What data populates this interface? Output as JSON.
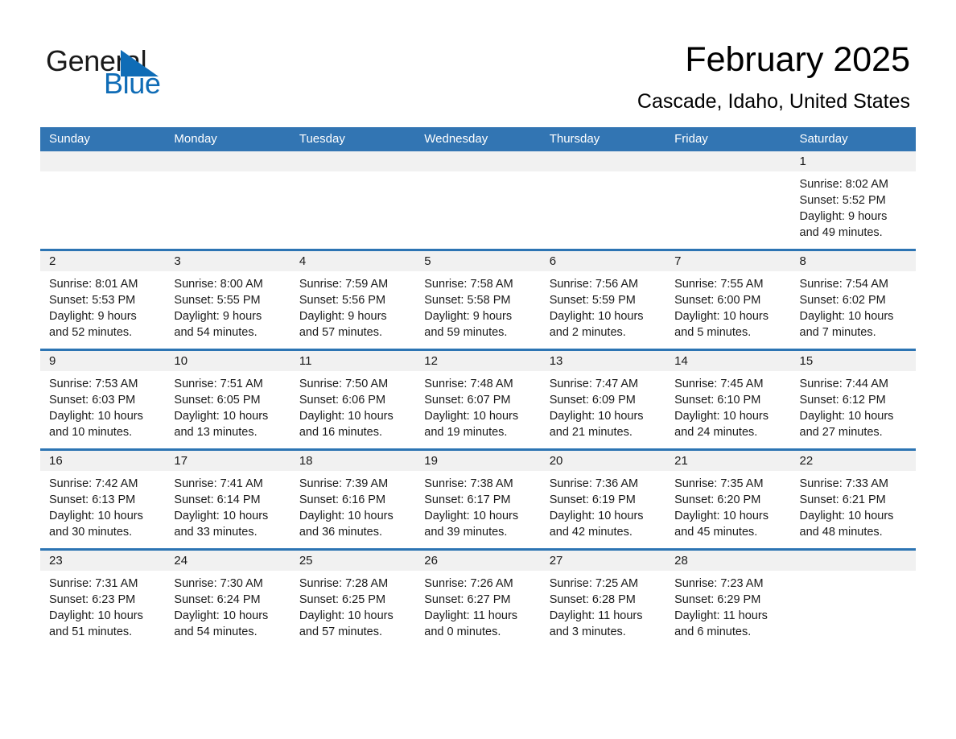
{
  "brand": {
    "name_part1": "General",
    "name_part2": "Blue",
    "logo_icon": "triangle-logo-icon",
    "accent_color": "#0f6cb6"
  },
  "header": {
    "title": "February 2025",
    "subtitle": "Cascade, Idaho, United States"
  },
  "calendar": {
    "header_bg": "#3275b3",
    "row_rule_color": "#2c74b3",
    "daynum_band_bg": "#f1f1f1",
    "weekdays": [
      "Sunday",
      "Monday",
      "Tuesday",
      "Wednesday",
      "Thursday",
      "Friday",
      "Saturday"
    ],
    "weeks": [
      [
        {
          "day": ""
        },
        {
          "day": ""
        },
        {
          "day": ""
        },
        {
          "day": ""
        },
        {
          "day": ""
        },
        {
          "day": ""
        },
        {
          "day": "1",
          "sunrise": "Sunrise: 8:02 AM",
          "sunset": "Sunset: 5:52 PM",
          "daylight_line1": "Daylight: 9 hours",
          "daylight_line2": "and 49 minutes."
        }
      ],
      [
        {
          "day": "2",
          "sunrise": "Sunrise: 8:01 AM",
          "sunset": "Sunset: 5:53 PM",
          "daylight_line1": "Daylight: 9 hours",
          "daylight_line2": "and 52 minutes."
        },
        {
          "day": "3",
          "sunrise": "Sunrise: 8:00 AM",
          "sunset": "Sunset: 5:55 PM",
          "daylight_line1": "Daylight: 9 hours",
          "daylight_line2": "and 54 minutes."
        },
        {
          "day": "4",
          "sunrise": "Sunrise: 7:59 AM",
          "sunset": "Sunset: 5:56 PM",
          "daylight_line1": "Daylight: 9 hours",
          "daylight_line2": "and 57 minutes."
        },
        {
          "day": "5",
          "sunrise": "Sunrise: 7:58 AM",
          "sunset": "Sunset: 5:58 PM",
          "daylight_line1": "Daylight: 9 hours",
          "daylight_line2": "and 59 minutes."
        },
        {
          "day": "6",
          "sunrise": "Sunrise: 7:56 AM",
          "sunset": "Sunset: 5:59 PM",
          "daylight_line1": "Daylight: 10 hours",
          "daylight_line2": "and 2 minutes."
        },
        {
          "day": "7",
          "sunrise": "Sunrise: 7:55 AM",
          "sunset": "Sunset: 6:00 PM",
          "daylight_line1": "Daylight: 10 hours",
          "daylight_line2": "and 5 minutes."
        },
        {
          "day": "8",
          "sunrise": "Sunrise: 7:54 AM",
          "sunset": "Sunset: 6:02 PM",
          "daylight_line1": "Daylight: 10 hours",
          "daylight_line2": "and 7 minutes."
        }
      ],
      [
        {
          "day": "9",
          "sunrise": "Sunrise: 7:53 AM",
          "sunset": "Sunset: 6:03 PM",
          "daylight_line1": "Daylight: 10 hours",
          "daylight_line2": "and 10 minutes."
        },
        {
          "day": "10",
          "sunrise": "Sunrise: 7:51 AM",
          "sunset": "Sunset: 6:05 PM",
          "daylight_line1": "Daylight: 10 hours",
          "daylight_line2": "and 13 minutes."
        },
        {
          "day": "11",
          "sunrise": "Sunrise: 7:50 AM",
          "sunset": "Sunset: 6:06 PM",
          "daylight_line1": "Daylight: 10 hours",
          "daylight_line2": "and 16 minutes."
        },
        {
          "day": "12",
          "sunrise": "Sunrise: 7:48 AM",
          "sunset": "Sunset: 6:07 PM",
          "daylight_line1": "Daylight: 10 hours",
          "daylight_line2": "and 19 minutes."
        },
        {
          "day": "13",
          "sunrise": "Sunrise: 7:47 AM",
          "sunset": "Sunset: 6:09 PM",
          "daylight_line1": "Daylight: 10 hours",
          "daylight_line2": "and 21 minutes."
        },
        {
          "day": "14",
          "sunrise": "Sunrise: 7:45 AM",
          "sunset": "Sunset: 6:10 PM",
          "daylight_line1": "Daylight: 10 hours",
          "daylight_line2": "and 24 minutes."
        },
        {
          "day": "15",
          "sunrise": "Sunrise: 7:44 AM",
          "sunset": "Sunset: 6:12 PM",
          "daylight_line1": "Daylight: 10 hours",
          "daylight_line2": "and 27 minutes."
        }
      ],
      [
        {
          "day": "16",
          "sunrise": "Sunrise: 7:42 AM",
          "sunset": "Sunset: 6:13 PM",
          "daylight_line1": "Daylight: 10 hours",
          "daylight_line2": "and 30 minutes."
        },
        {
          "day": "17",
          "sunrise": "Sunrise: 7:41 AM",
          "sunset": "Sunset: 6:14 PM",
          "daylight_line1": "Daylight: 10 hours",
          "daylight_line2": "and 33 minutes."
        },
        {
          "day": "18",
          "sunrise": "Sunrise: 7:39 AM",
          "sunset": "Sunset: 6:16 PM",
          "daylight_line1": "Daylight: 10 hours",
          "daylight_line2": "and 36 minutes."
        },
        {
          "day": "19",
          "sunrise": "Sunrise: 7:38 AM",
          "sunset": "Sunset: 6:17 PM",
          "daylight_line1": "Daylight: 10 hours",
          "daylight_line2": "and 39 minutes."
        },
        {
          "day": "20",
          "sunrise": "Sunrise: 7:36 AM",
          "sunset": "Sunset: 6:19 PM",
          "daylight_line1": "Daylight: 10 hours",
          "daylight_line2": "and 42 minutes."
        },
        {
          "day": "21",
          "sunrise": "Sunrise: 7:35 AM",
          "sunset": "Sunset: 6:20 PM",
          "daylight_line1": "Daylight: 10 hours",
          "daylight_line2": "and 45 minutes."
        },
        {
          "day": "22",
          "sunrise": "Sunrise: 7:33 AM",
          "sunset": "Sunset: 6:21 PM",
          "daylight_line1": "Daylight: 10 hours",
          "daylight_line2": "and 48 minutes."
        }
      ],
      [
        {
          "day": "23",
          "sunrise": "Sunrise: 7:31 AM",
          "sunset": "Sunset: 6:23 PM",
          "daylight_line1": "Daylight: 10 hours",
          "daylight_line2": "and 51 minutes."
        },
        {
          "day": "24",
          "sunrise": "Sunrise: 7:30 AM",
          "sunset": "Sunset: 6:24 PM",
          "daylight_line1": "Daylight: 10 hours",
          "daylight_line2": "and 54 minutes."
        },
        {
          "day": "25",
          "sunrise": "Sunrise: 7:28 AM",
          "sunset": "Sunset: 6:25 PM",
          "daylight_line1": "Daylight: 10 hours",
          "daylight_line2": "and 57 minutes."
        },
        {
          "day": "26",
          "sunrise": "Sunrise: 7:26 AM",
          "sunset": "Sunset: 6:27 PM",
          "daylight_line1": "Daylight: 11 hours",
          "daylight_line2": "and 0 minutes."
        },
        {
          "day": "27",
          "sunrise": "Sunrise: 7:25 AM",
          "sunset": "Sunset: 6:28 PM",
          "daylight_line1": "Daylight: 11 hours",
          "daylight_line2": "and 3 minutes."
        },
        {
          "day": "28",
          "sunrise": "Sunrise: 7:23 AM",
          "sunset": "Sunset: 6:29 PM",
          "daylight_line1": "Daylight: 11 hours",
          "daylight_line2": "and 6 minutes."
        },
        {
          "day": ""
        }
      ]
    ]
  }
}
